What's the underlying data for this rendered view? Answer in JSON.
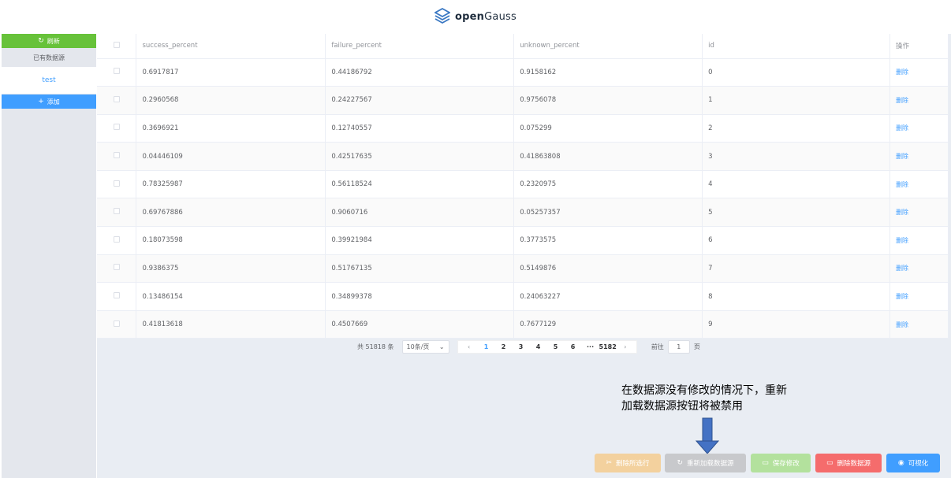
{
  "header": {
    "logo_open": "open",
    "logo_gauss": "Gauss"
  },
  "sidebar": {
    "refresh_label": "刷新",
    "sources_title": "已有数据源",
    "sources": [
      "test"
    ],
    "add_label": "添加"
  },
  "table": {
    "columns": [
      "success_percent",
      "failure_percent",
      "unknown_percent",
      "id",
      "操作"
    ],
    "rows": [
      [
        "0.6917817",
        "0.44186792",
        "0.9158162",
        "0",
        "删除"
      ],
      [
        "0.2960568",
        "0.24227567",
        "0.9756078",
        "1",
        "删除"
      ],
      [
        "0.3696921",
        "0.12740557",
        "0.075299",
        "2",
        "删除"
      ],
      [
        "0.04446109",
        "0.42517635",
        "0.41863808",
        "3",
        "删除"
      ],
      [
        "0.78325987",
        "0.56118524",
        "0.2320975",
        "4",
        "删除"
      ],
      [
        "0.69767886",
        "0.9060716",
        "0.05257357",
        "5",
        "删除"
      ],
      [
        "0.18073598",
        "0.39921984",
        "0.3773575",
        "6",
        "删除"
      ],
      [
        "0.9386375",
        "0.51767135",
        "0.5149876",
        "7",
        "删除"
      ],
      [
        "0.13486154",
        "0.34899378",
        "0.24063227",
        "8",
        "删除"
      ],
      [
        "0.41813618",
        "0.4507669",
        "0.7677129",
        "9",
        "删除"
      ]
    ]
  },
  "pagination": {
    "total": "共 51818 条",
    "page_size": "10条/页",
    "pages": [
      "1",
      "2",
      "3",
      "4",
      "5",
      "6",
      "···",
      "5182"
    ],
    "current_page": "1",
    "goto_prefix": "前往",
    "goto_value": "1",
    "goto_suffix": "页"
  },
  "annotation": {
    "line1": "在数据源没有修改的情况下，重新",
    "line2": "加载数据源按钮将被禁用"
  },
  "actions": {
    "delete_selected": "删除所选行",
    "reload_source": "重新加载数据源",
    "save_changes": "保存修改",
    "delete_source": "删除数据源",
    "visualize": "可视化"
  },
  "colors": {
    "primary": "#409eff",
    "success": "#67c23a",
    "danger": "#f56c6c",
    "warning_disabled": "#f3d19e",
    "info_disabled": "#c8c9cc",
    "success_disabled": "#b3e19d"
  }
}
